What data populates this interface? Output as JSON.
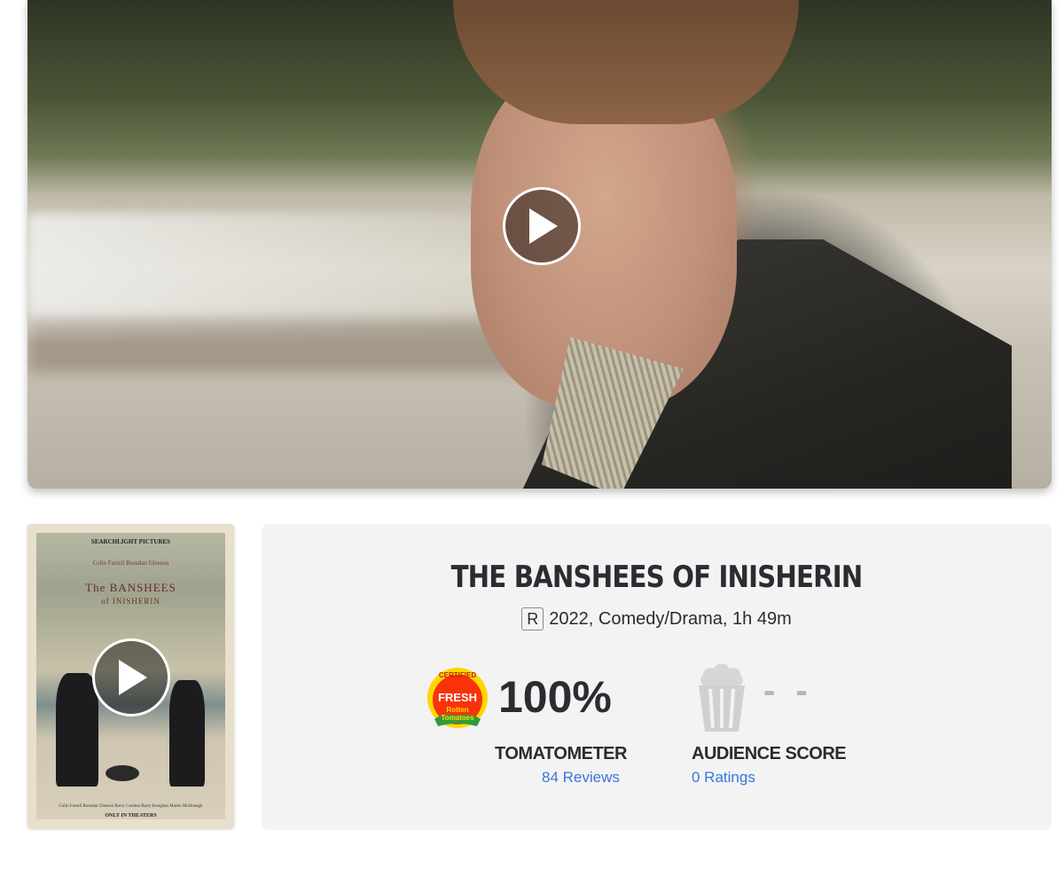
{
  "movie": {
    "title": "THE BANSHEES OF INISHERIN",
    "rating": "R",
    "details": "2022, Comedy/Drama, 1h 49m"
  },
  "tomatometer": {
    "score": "100%",
    "label": "TOMATOMETER",
    "reviews_link": "84 Reviews",
    "badge_text": [
      "CERTIFIED",
      "FRESH",
      "Rotten",
      "Tomatoes"
    ]
  },
  "audience": {
    "score": "- -",
    "label": "AUDIENCE SCORE",
    "ratings_link": "0 Ratings"
  },
  "poster": {
    "studio": "SEARCHLIGHT PICTURES",
    "cast": "Colin Farrell    Brendan Gleeson",
    "title_line1": "The BANSHEES",
    "title_line2": "of INISHERIN",
    "credits": "Colin Farrell  Brendan Gleeson  Kerry Condon  Barry Keoghan  Martin McDonagh",
    "footer": "ONLY IN THEATERS"
  },
  "colors": {
    "link": "#3976dc",
    "panel_bg": "#f3f3f3",
    "fresh_red": "#fa320a",
    "fresh_yellow": "#ffd700",
    "dash_gray": "#b5b5b5"
  },
  "icons": {
    "hero_play": "play-icon",
    "poster_play": "play-icon",
    "tomato": "certified-fresh-icon",
    "audience": "popcorn-empty-icon"
  }
}
